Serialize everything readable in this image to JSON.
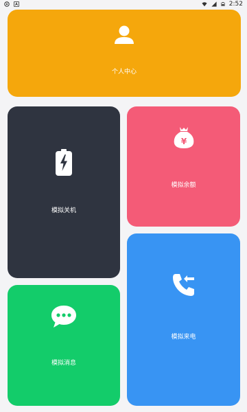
{
  "status_bar": {
    "time": "2:52",
    "icons": [
      "notification-icon",
      "a-icon",
      "wifi-icon",
      "signal-icon",
      "battery-icon"
    ]
  },
  "cards": {
    "profile": {
      "label": "个人中心",
      "color": "#f5a70c",
      "icon": "person-icon"
    },
    "shutdown": {
      "label": "模拟关机",
      "color": "#2f3440",
      "icon": "battery-charging-icon"
    },
    "balance": {
      "label": "模拟余额",
      "color": "#f45b77",
      "icon": "money-bag-icon"
    },
    "message": {
      "label": "模拟消息",
      "color": "#13cc6a",
      "icon": "chat-bubble-icon"
    },
    "call": {
      "label": "模拟来电",
      "color": "#3894f3",
      "icon": "incoming-call-icon"
    }
  }
}
